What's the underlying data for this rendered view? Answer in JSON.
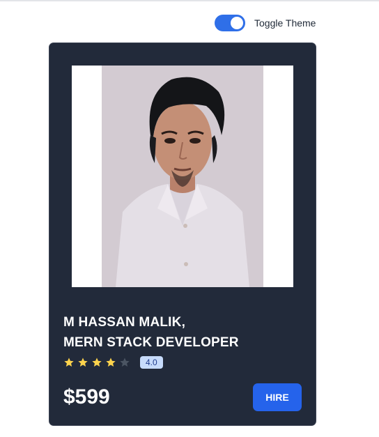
{
  "theme_toggle": {
    "label": "Toggle Theme",
    "on": true,
    "color": "#2f6fe8"
  },
  "card": {
    "name_line1": "M HASSAN MALIK,",
    "name_line2": "MERN STACK DEVELOPER",
    "rating": 4,
    "rating_max": 5,
    "rating_label": "4.0",
    "price": "$599",
    "hire_label": "HIRE",
    "colors": {
      "card_bg": "#222a3a",
      "star_filled": "#fcd34d",
      "star_empty": "#4b5563",
      "button": "#2563eb"
    }
  }
}
